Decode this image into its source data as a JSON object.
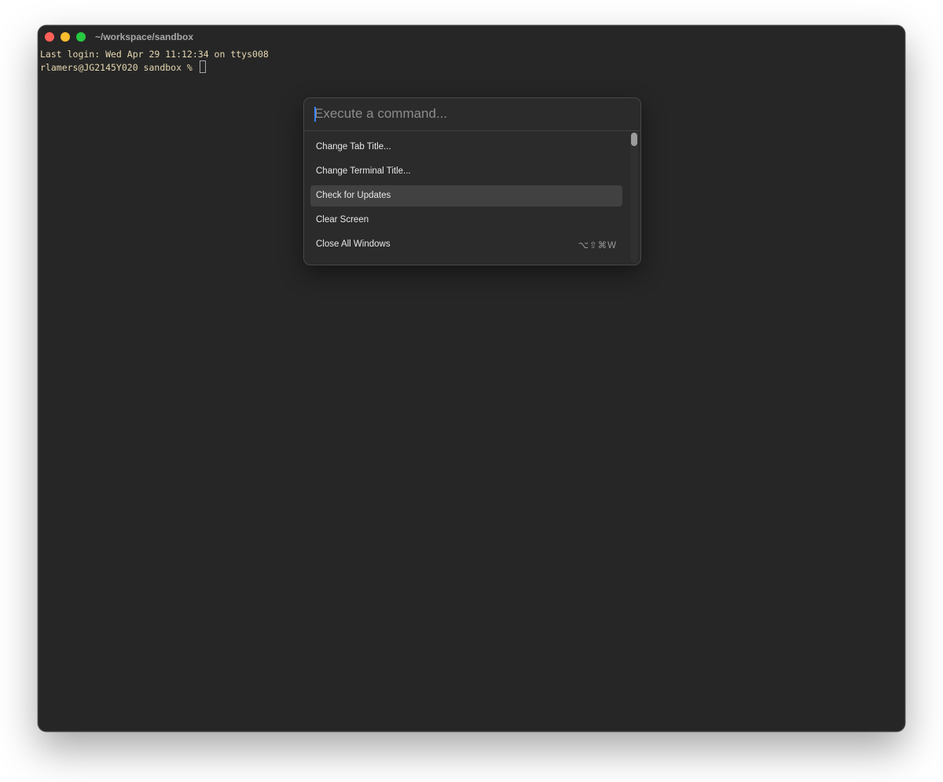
{
  "window": {
    "title": "~/workspace/sandbox",
    "colors": {
      "close": "#fe5f57",
      "minimize": "#febc2e",
      "maximize": "#28c840"
    }
  },
  "terminal": {
    "line1": "Last login: Wed Apr 29 11:12:34 on ttys008",
    "prompt": "rlamers@JG2145Y020 sandbox % "
  },
  "command_palette": {
    "search": {
      "placeholder": "Execute a command...",
      "value": ""
    },
    "items": [
      {
        "label": "Change Tab Title...",
        "shortcut": "",
        "selected": false
      },
      {
        "label": "Change Terminal Title...",
        "shortcut": "",
        "selected": false
      },
      {
        "label": "Check for Updates",
        "shortcut": "",
        "selected": true
      },
      {
        "label": "Clear Screen",
        "shortcut": "",
        "selected": false
      },
      {
        "label": "Close All Windows",
        "shortcut": "⌥⇧⌘W",
        "selected": false
      }
    ],
    "accent_color": "#3b82f6"
  }
}
